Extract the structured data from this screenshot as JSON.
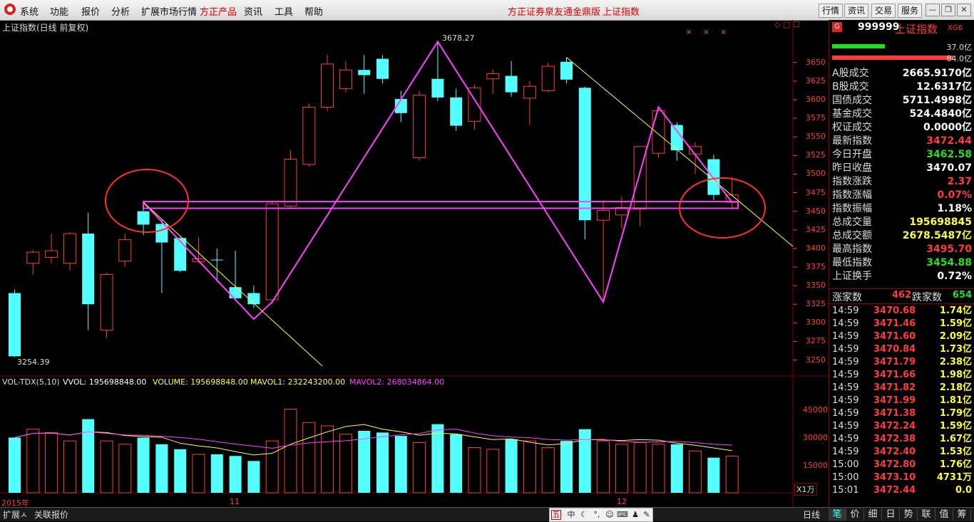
{
  "menubar": {
    "items": [
      "系统",
      "功能",
      "报价",
      "分析",
      "扩展市场行情",
      "方正产品",
      "资讯",
      "工具",
      "帮助"
    ],
    "center_title": "方正证券泉友通金鼎版",
    "center_sub": "上证指数",
    "right_buttons": [
      "行情",
      "资讯",
      "交易",
      "服务"
    ]
  },
  "chart": {
    "title": "上证指数(日线 前复权)",
    "high_label": "3678.27",
    "low_label": "3254.39",
    "price_ticks": [
      "3650",
      "3625",
      "3600",
      "3575",
      "3550",
      "3525",
      "3500",
      "3475",
      "3450",
      "3425",
      "3400",
      "3375",
      "3350",
      "3325",
      "3300",
      "3275",
      "3250"
    ],
    "vol_header": {
      "name": "VOL-TDX(5,10)",
      "vvol": "VVOL: 195698848.00",
      "volume": "VOLUME: 195698848.00",
      "mavol1": "MAVOL1: 232243200.00",
      "mavol2": "MAVOL2: 268034864.00"
    },
    "vol_ticks": [
      "45000",
      "30000",
      "15000"
    ],
    "vol_unit": "X1万",
    "x_labels": [
      "2015年",
      "11",
      "12"
    ]
  },
  "chart_data": {
    "type": "candlestick",
    "title": "上证指数(日线 前复权)",
    "ylim": [
      3240,
      3690
    ],
    "candles": [
      {
        "o": 3340,
        "c": 3255,
        "h": 3345,
        "l": 3254
      },
      {
        "o": 3380,
        "c": 3395,
        "h": 3398,
        "l": 3365
      },
      {
        "o": 3388,
        "c": 3397,
        "h": 3420,
        "l": 3380
      },
      {
        "o": 3380,
        "c": 3420,
        "h": 3422,
        "l": 3370
      },
      {
        "o": 3420,
        "c": 3325,
        "h": 3448,
        "l": 3290
      },
      {
        "o": 3290,
        "c": 3365,
        "h": 3367,
        "l": 3280
      },
      {
        "o": 3383,
        "c": 3412,
        "h": 3420,
        "l": 3375
      },
      {
        "o": 3450,
        "c": 3432,
        "h": 3462,
        "l": 3418
      },
      {
        "o": 3433,
        "c": 3408,
        "h": 3440,
        "l": 3340
      },
      {
        "o": 3414,
        "c": 3370,
        "h": 3415,
        "l": 3368
      },
      {
        "o": 3382,
        "c": 3386,
        "h": 3415,
        "l": 3380
      },
      {
        "o": 3385,
        "c": 3384,
        "h": 3400,
        "l": 3355
      },
      {
        "o": 3348,
        "c": 3333,
        "h": 3397,
        "l": 3330
      },
      {
        "o": 3340,
        "c": 3325,
        "h": 3350,
        "l": 3320
      },
      {
        "o": 3331,
        "c": 3460,
        "h": 3462,
        "l": 3325
      },
      {
        "o": 3457,
        "c": 3520,
        "h": 3532,
        "l": 3455
      },
      {
        "o": 3513,
        "c": 3590,
        "h": 3595,
        "l": 3510
      },
      {
        "o": 3590,
        "c": 3648,
        "h": 3660,
        "l": 3585
      },
      {
        "o": 3615,
        "c": 3640,
        "h": 3652,
        "l": 3610
      },
      {
        "o": 3640,
        "c": 3633,
        "h": 3660,
        "l": 3608
      },
      {
        "o": 3655,
        "c": 3628,
        "h": 3660,
        "l": 3622
      },
      {
        "o": 3601,
        "c": 3582,
        "h": 3612,
        "l": 3570
      },
      {
        "o": 3522,
        "c": 3606,
        "h": 3612,
        "l": 3518
      },
      {
        "o": 3628,
        "c": 3603,
        "h": 3678,
        "l": 3598
      },
      {
        "o": 3603,
        "c": 3565,
        "h": 3615,
        "l": 3558
      },
      {
        "o": 3571,
        "c": 3616,
        "h": 3620,
        "l": 3560
      },
      {
        "o": 3628,
        "c": 3635,
        "h": 3640,
        "l": 3608
      },
      {
        "o": 3632,
        "c": 3610,
        "h": 3652,
        "l": 3604
      },
      {
        "o": 3602,
        "c": 3618,
        "h": 3625,
        "l": 3566
      },
      {
        "o": 3612,
        "c": 3645,
        "h": 3650,
        "l": 3610
      },
      {
        "o": 3651,
        "c": 3627,
        "h": 3657,
        "l": 3622
      },
      {
        "o": 3616,
        "c": 3438,
        "h": 3618,
        "l": 3412
      },
      {
        "o": 3438,
        "c": 3451,
        "h": 3465,
        "l": 3330
      },
      {
        "o": 3445,
        "c": 3455,
        "h": 3470,
        "l": 3427
      },
      {
        "o": 3453,
        "c": 3537,
        "h": 3538,
        "l": 3430
      },
      {
        "o": 3528,
        "c": 3585,
        "h": 3591,
        "l": 3522
      },
      {
        "o": 3566,
        "c": 3532,
        "h": 3570,
        "l": 3518
      },
      {
        "o": 3527,
        "c": 3537,
        "h": 3543,
        "l": 3500
      },
      {
        "o": 3520,
        "c": 3472,
        "h": 3526,
        "l": 3465
      },
      {
        "o": 3462,
        "c": 3472,
        "h": 3496,
        "l": 3455
      }
    ],
    "volume": [
      33000,
      38000,
      36000,
      31000,
      44000,
      31000,
      29000,
      33000,
      29000,
      26000,
      23000,
      23000,
      22000,
      19000,
      31000,
      50000,
      42000,
      40000,
      35000,
      37000,
      36000,
      34000,
      30000,
      41000,
      35000,
      27000,
      26000,
      32000,
      31000,
      27000,
      31000,
      38000,
      31000,
      29000,
      30000,
      29000,
      29000,
      25000,
      21000,
      22000
    ],
    "vol_ylim": [
      0,
      57000
    ]
  },
  "quote": {
    "code": "999999",
    "name": "上证指数",
    "tag": "XG6",
    "bar1_value": "37.0亿",
    "bar2_value": "84.0亿",
    "rows": [
      {
        "label": "A股成交",
        "value": "2665.9170亿",
        "color": "white"
      },
      {
        "label": "B股成交",
        "value": "12.6317亿",
        "color": "white"
      },
      {
        "label": "国债成交",
        "value": "5711.4998亿",
        "color": "white"
      },
      {
        "label": "基金成交",
        "value": "524.4840亿",
        "color": "white"
      },
      {
        "label": "权证成交",
        "value": "0.0000亿",
        "color": "white"
      },
      {
        "label": "最新指数",
        "value": "3472.44",
        "color": "red"
      },
      {
        "label": "今日开盘",
        "value": "3462.58",
        "color": "green"
      },
      {
        "label": "昨日收盘",
        "value": "3470.07",
        "color": "white"
      },
      {
        "label": "指数涨跌",
        "value": "2.37",
        "color": "red"
      },
      {
        "label": "指数涨幅",
        "value": "0.07%",
        "color": "red"
      },
      {
        "label": "指数振幅",
        "value": "1.18%",
        "color": "white"
      },
      {
        "label": "总成交量",
        "value": "195698845",
        "color": "yellow"
      },
      {
        "label": "总成交额",
        "value": "2678.5487亿",
        "color": "yellow"
      },
      {
        "label": "最高指数",
        "value": "3495.70",
        "color": "red"
      },
      {
        "label": "最低指数",
        "value": "3454.88",
        "color": "green"
      },
      {
        "label": "上证换手",
        "value": "0.72%",
        "color": "white"
      }
    ],
    "up_label": "涨家数",
    "up_count": "462",
    "down_label": "跌家数",
    "down_count": "654",
    "ticks": [
      {
        "t": "14:59",
        "p": "3470.68",
        "v": "1.74亿",
        "pc": "red",
        "vc": "yellow"
      },
      {
        "t": "14:59",
        "p": "3471.46",
        "v": "1.59亿",
        "pc": "red",
        "vc": "yellow"
      },
      {
        "t": "14:59",
        "p": "3471.60",
        "v": "2.09亿",
        "pc": "red",
        "vc": "yellow"
      },
      {
        "t": "14:59",
        "p": "3470.84",
        "v": "1.73亿",
        "pc": "red",
        "vc": "yellow"
      },
      {
        "t": "14:59",
        "p": "3471.79",
        "v": "2.38亿",
        "pc": "red",
        "vc": "yellow"
      },
      {
        "t": "14:59",
        "p": "3471.66",
        "v": "1.98亿",
        "pc": "red",
        "vc": "yellow"
      },
      {
        "t": "14:59",
        "p": "3471.82",
        "v": "2.18亿",
        "pc": "red",
        "vc": "yellow"
      },
      {
        "t": "14:59",
        "p": "3471.99",
        "v": "1.81亿",
        "pc": "red",
        "vc": "yellow"
      },
      {
        "t": "14:59",
        "p": "3471.38",
        "v": "1.79亿",
        "pc": "red",
        "vc": "yellow"
      },
      {
        "t": "14:59",
        "p": "3472.24",
        "v": "1.59亿",
        "pc": "red",
        "vc": "yellow"
      },
      {
        "t": "14:59",
        "p": "3472.38",
        "v": "1.67亿",
        "pc": "red",
        "vc": "yellow"
      },
      {
        "t": "14:59",
        "p": "3472.40",
        "v": "1.53亿",
        "pc": "red",
        "vc": "yellow"
      },
      {
        "t": "15:00",
        "p": "3472.80",
        "v": "1.76亿",
        "pc": "red",
        "vc": "yellow"
      },
      {
        "t": "15:00",
        "p": "3473.10",
        "v": "4731万",
        "pc": "red",
        "vc": "yellow"
      },
      {
        "t": "15:01",
        "p": "3472.44",
        "v": "0.0",
        "pc": "red",
        "vc": "yellow"
      }
    ]
  },
  "bottom": {
    "tabs": [
      "扩展ㅅ",
      "关联报价"
    ],
    "day_label": "日线",
    "icons": [
      "五",
      "中"
    ],
    "right_tabs": [
      "笔",
      "价",
      "细",
      "日",
      "势",
      "联",
      "值",
      "筹"
    ]
  },
  "colors": {
    "up": "#ff3c3c",
    "down": "#54ffff",
    "magenta": "#ff40ff",
    "yellowline": "#ffff40",
    "grid": "#800000"
  }
}
